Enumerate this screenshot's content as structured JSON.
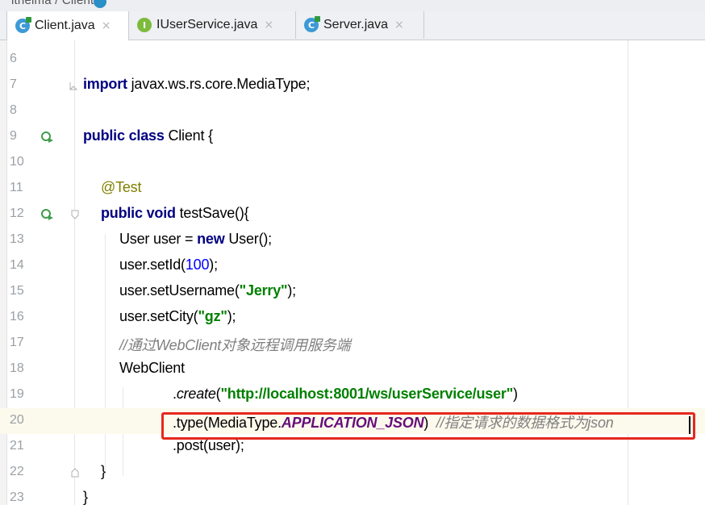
{
  "breadcrumb": {
    "text": "itheima / Client /"
  },
  "tabs": [
    {
      "label": "Client.java",
      "icon": "java-class-icon",
      "active": true,
      "close": "×"
    },
    {
      "label": "IUserService.java",
      "icon": "java-interface-icon",
      "active": false,
      "close": "×"
    },
    {
      "label": "Server.java",
      "icon": "java-class-icon",
      "active": false,
      "close": "×"
    }
  ],
  "editor": {
    "line_numbers": [
      "6",
      "7",
      "8",
      "9",
      "10",
      "11",
      "12",
      "13",
      "14",
      "15",
      "16",
      "17",
      "18",
      "19",
      "20",
      "21",
      "22",
      "23"
    ],
    "lines": {
      "l7": {
        "kw": "import",
        "rest": " javax.ws.rs.core.MediaType;"
      },
      "l9": {
        "kw": "public class",
        "rest": " Client {"
      },
      "l11": {
        "anno": "@Test"
      },
      "l12": {
        "kw": "public void",
        "rest": " testSave(){"
      },
      "l13": {
        "a": "User user = ",
        "kw": "new",
        "b": " User();"
      },
      "l14": {
        "a": "user.setId(",
        "num": "100",
        "b": ");"
      },
      "l15": {
        "a": "user.setUsername(",
        "str": "\"Jerry\"",
        "b": ");"
      },
      "l16": {
        "a": "user.setCity(",
        "str": "\"gz\"",
        "b": ");"
      },
      "l17": {
        "comment": "//通过WebClient对象远程调用服务端"
      },
      "l18": {
        "a": "WebClient"
      },
      "l19": {
        "a": ".",
        "method": "create",
        "b": "(",
        "str": "\"http://localhost:8001/ws/userService/user\"",
        "c": ")"
      },
      "l20": {
        "a": ".type(MediaType.",
        "const": "APPLICATION_JSON",
        "b": ")",
        "comment": "  //指定请求的数据格式为json"
      },
      "l21": {
        "a": ".post(user);"
      },
      "l22": {
        "a": "}"
      },
      "l23": {
        "a": "}"
      }
    },
    "current_line": "20"
  },
  "colors": {
    "keyword": "#000080",
    "string": "#008000",
    "number": "#0000ff",
    "annotation": "#808000",
    "comment": "#808080",
    "constant": "#660e7a",
    "highlight_box": "#e5281e"
  }
}
